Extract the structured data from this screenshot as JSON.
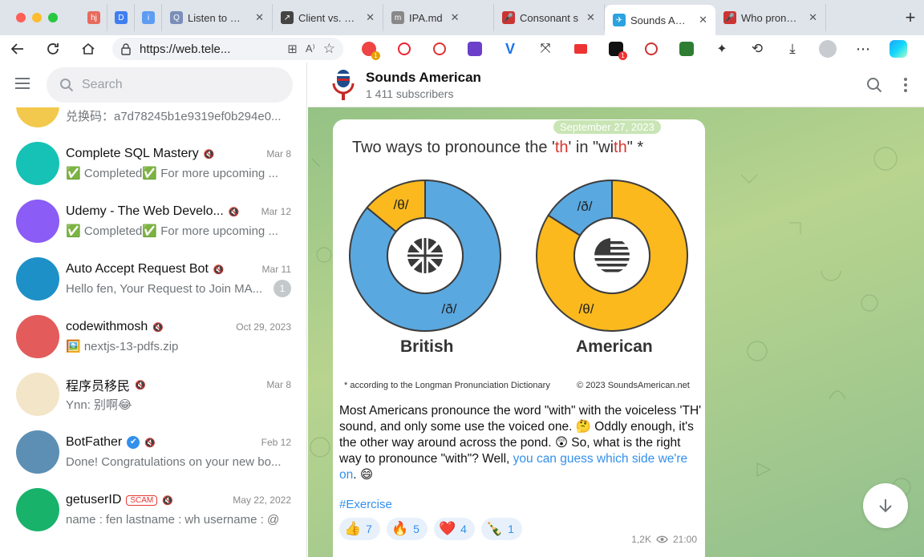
{
  "browser": {
    "tabs": [
      {
        "title": "",
        "fav_color": "#e86a5d",
        "fav_glyph": "hj"
      },
      {
        "title": "",
        "fav_color": "#3f7ef0",
        "fav_glyph": "D"
      },
      {
        "title": "",
        "fav_color": "#5e9cf2",
        "fav_glyph": "i"
      },
      {
        "title": "Listen to Eng",
        "fav_color": "#7a8fb8",
        "fav_glyph": "Q"
      },
      {
        "title": "Client vs. Ser",
        "fav_color": "#444",
        "fav_glyph": "↗"
      },
      {
        "title": "IPA.md",
        "fav_color": "#888",
        "fav_glyph": "m"
      },
      {
        "title": "Consonant s",
        "fav_color": "#c33",
        "fav_glyph": "🎤"
      },
      {
        "title": "Sounds Amer",
        "fav_color": "#2aa3e0",
        "fav_glyph": "✈",
        "active": true
      },
      {
        "title": "Who pronour",
        "fav_color": "#c33",
        "fav_glyph": "🎤"
      }
    ],
    "url": "https://web.tele...",
    "new_tab": "+"
  },
  "sidebar": {
    "search_placeholder": "Search",
    "chats": [
      {
        "name": "",
        "preview": "兑换码：a7d78245b1e9319ef0b294e0...",
        "date": "",
        "avatar_color": "#f2c94c",
        "muted": false
      },
      {
        "name": "Complete SQL Mastery",
        "preview": "✅ Completed✅ For more upcoming ...",
        "date": "Mar 8",
        "avatar_color": "#16c2b5",
        "muted": true
      },
      {
        "name": "Udemy - The Web Develo...",
        "preview": "✅ Completed✅ For more upcoming ...",
        "date": "Mar 12",
        "avatar_color": "#8b5cf6",
        "muted": true
      },
      {
        "name": "Auto Accept Request Bot",
        "preview": "Hello fen, Your Request to Join MA...",
        "date": "Mar 11",
        "avatar_color": "#1e90c8",
        "muted": true,
        "unread": "1"
      },
      {
        "name": "codewithmosh",
        "preview": "🖼️ nextjs-13-pdfs.zip",
        "date": "Oct 29, 2023",
        "avatar_color": "#e35b5b",
        "muted": true
      },
      {
        "name": "程序员移民",
        "preview": "Ynn: 别啊😂",
        "date": "Mar 8",
        "avatar_color": "#f3e5c8",
        "muted": true
      },
      {
        "name": "BotFather",
        "preview": "Done! Congratulations on your new bo...",
        "date": "Feb 12",
        "avatar_color": "#5c8fb3",
        "muted": true,
        "verified": true
      },
      {
        "name": "getuserID",
        "preview": "name : fen lastname : wh username : @",
        "date": "May 22, 2022",
        "avatar_color": "#18b26b",
        "muted": true,
        "scam": "SCAM"
      }
    ]
  },
  "channel": {
    "title": "Sounds American",
    "subtitle": "1 411 subscribers"
  },
  "post": {
    "date": "September 27, 2023",
    "image": {
      "title_pre": "Two ways to pronounce the '",
      "title_th": "th",
      "title_mid": "' in \"wi",
      "title_th2": "th",
      "title_post": "\"  *",
      "left_label": "British",
      "right_label": "American",
      "british_minor": "/θ/",
      "british_major": "/ð/",
      "american_minor": "/ð/",
      "american_major": "/θ/",
      "british_voiced_share": 0.86,
      "american_voiced_share": 0.16,
      "footnote_left": "* according to the Longman Pronunciation Dictionary",
      "footnote_right": "© 2023 SoundsAmerican.net",
      "colors": {
        "blue": "#5aa8e0",
        "yellow": "#fbb91d"
      }
    },
    "text_main": "Most Americans pronounce the word \"with\" with the voiceless 'TH' sound, and only some use the voiced one. 🤔 Oddly enough, it's the other way around across the pond. 😲 So, what is the right way to pronounce \"with\"? Well, ",
    "text_link": "you can guess which side we're on",
    "text_end": ". 😄",
    "hashtag": "#Exercise",
    "reactions": [
      {
        "emoji": "👍",
        "count": "7"
      },
      {
        "emoji": "🔥",
        "count": "5"
      },
      {
        "emoji": "❤️",
        "count": "4"
      },
      {
        "emoji": "🍾",
        "count": "1"
      }
    ],
    "views": "1,2K",
    "time": "21:00"
  }
}
